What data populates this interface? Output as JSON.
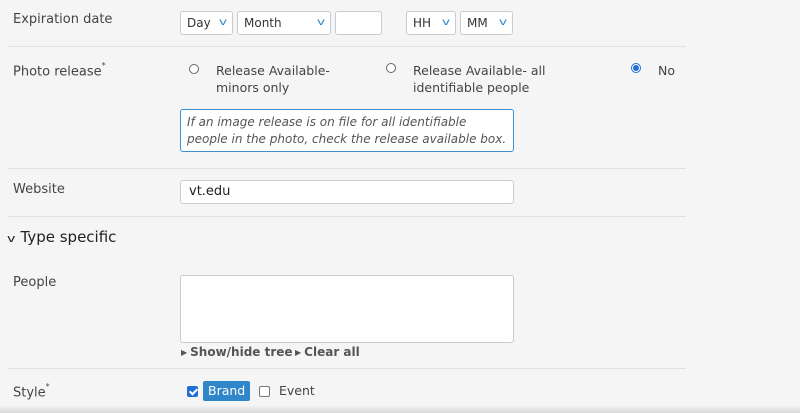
{
  "expiration": {
    "label": "Expiration date",
    "day": "Day",
    "month": "Month",
    "year": "",
    "hour": "HH",
    "minute": "MM"
  },
  "photo_release": {
    "label": "Photo release",
    "required_mark": "*",
    "options": [
      {
        "label_line1": "Release Available-",
        "label_line2": "minors only",
        "selected": false
      },
      {
        "label_line1": "Release Available- all",
        "label_line2": "identifiable people",
        "selected": false
      },
      {
        "label_line1": "No",
        "label_line2": "",
        "selected": true
      }
    ],
    "help_text": "If an image release is on file for all identifiable people in the photo, check the release available box."
  },
  "website": {
    "label": "Website",
    "value": "vt.edu"
  },
  "type_specific": {
    "title": "Type specific"
  },
  "people": {
    "label": "People",
    "value": "",
    "show_hide_tree": "Show/hide tree",
    "clear_all": "Clear all"
  },
  "style": {
    "label": "Style",
    "required_mark": "*",
    "options": [
      {
        "label": "Brand",
        "checked": true
      },
      {
        "label": "Event",
        "checked": false
      }
    ]
  },
  "colors": {
    "accent": "#2f86c9",
    "radio_selected": "#1f6fd6",
    "background": "#f5f5f5"
  },
  "icons": [
    "chevron-down-icon",
    "caret-right-icon",
    "checkmark-icon"
  ]
}
